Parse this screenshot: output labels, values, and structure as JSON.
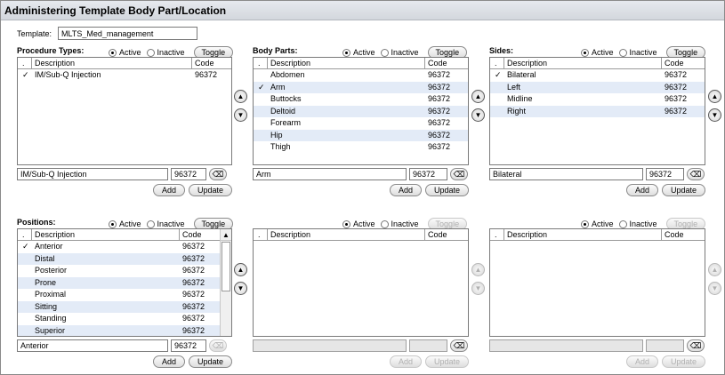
{
  "window": {
    "title": "Administering Template Body Part/Location"
  },
  "template": {
    "label": "Template:",
    "value": "MLTS_Med_management"
  },
  "common": {
    "active_label": "Active",
    "inactive_label": "Inactive",
    "toggle_label": "Toggle",
    "add_label": "Add",
    "update_label": "Update",
    "col_chk": ".",
    "col_desc": "Description",
    "col_code": "Code",
    "check_mark": "✓",
    "icons": {
      "up": "up-arrow-icon",
      "down": "down-arrow-icon",
      "eraser": "eraser-icon",
      "scroll_up": "scroll-up-icon"
    }
  },
  "procedure_types": {
    "title": "Procedure Types:",
    "rows": [
      {
        "check": "✓",
        "desc": "IM/Sub-Q Injection",
        "code": "96372"
      }
    ],
    "edit_desc": "IM/Sub-Q Injection",
    "edit_code": "96372"
  },
  "body_parts": {
    "title": "Body Parts:",
    "rows": [
      {
        "check": "",
        "desc": "Abdomen",
        "code": "96372"
      },
      {
        "check": "✓",
        "desc": "Arm",
        "code": "96372"
      },
      {
        "check": "",
        "desc": "Buttocks",
        "code": "96372"
      },
      {
        "check": "",
        "desc": "Deltoid",
        "code": "96372"
      },
      {
        "check": "",
        "desc": "Forearm",
        "code": "96372"
      },
      {
        "check": "",
        "desc": "Hip",
        "code": "96372"
      },
      {
        "check": "",
        "desc": "Thigh",
        "code": "96372"
      }
    ],
    "edit_desc": "Arm",
    "edit_code": "96372"
  },
  "sides": {
    "title": "Sides:",
    "rows": [
      {
        "check": "✓",
        "desc": "Bilateral",
        "code": "96372"
      },
      {
        "check": "",
        "desc": "Left",
        "code": "96372"
      },
      {
        "check": "",
        "desc": "Midline",
        "code": "96372"
      },
      {
        "check": "",
        "desc": "Right",
        "code": "96372"
      }
    ],
    "edit_desc": "Bilateral",
    "edit_code": "96372"
  },
  "positions": {
    "title": "Positions:",
    "rows": [
      {
        "check": "✓",
        "desc": "Anterior",
        "code": "96372"
      },
      {
        "check": "",
        "desc": "Distal",
        "code": "96372"
      },
      {
        "check": "",
        "desc": "Posterior",
        "code": "96372"
      },
      {
        "check": "",
        "desc": "Prone",
        "code": "96372"
      },
      {
        "check": "",
        "desc": "Proximal",
        "code": "96372"
      },
      {
        "check": "",
        "desc": "Sitting",
        "code": "96372"
      },
      {
        "check": "",
        "desc": "Standing",
        "code": "96372"
      },
      {
        "check": "",
        "desc": "Superior",
        "code": "96372"
      }
    ],
    "edit_desc": "Anterior",
    "edit_code": "96372"
  },
  "panel5": {
    "rows": [],
    "edit_desc": "",
    "edit_code": ""
  },
  "panel6": {
    "rows": [],
    "edit_desc": "",
    "edit_code": ""
  }
}
